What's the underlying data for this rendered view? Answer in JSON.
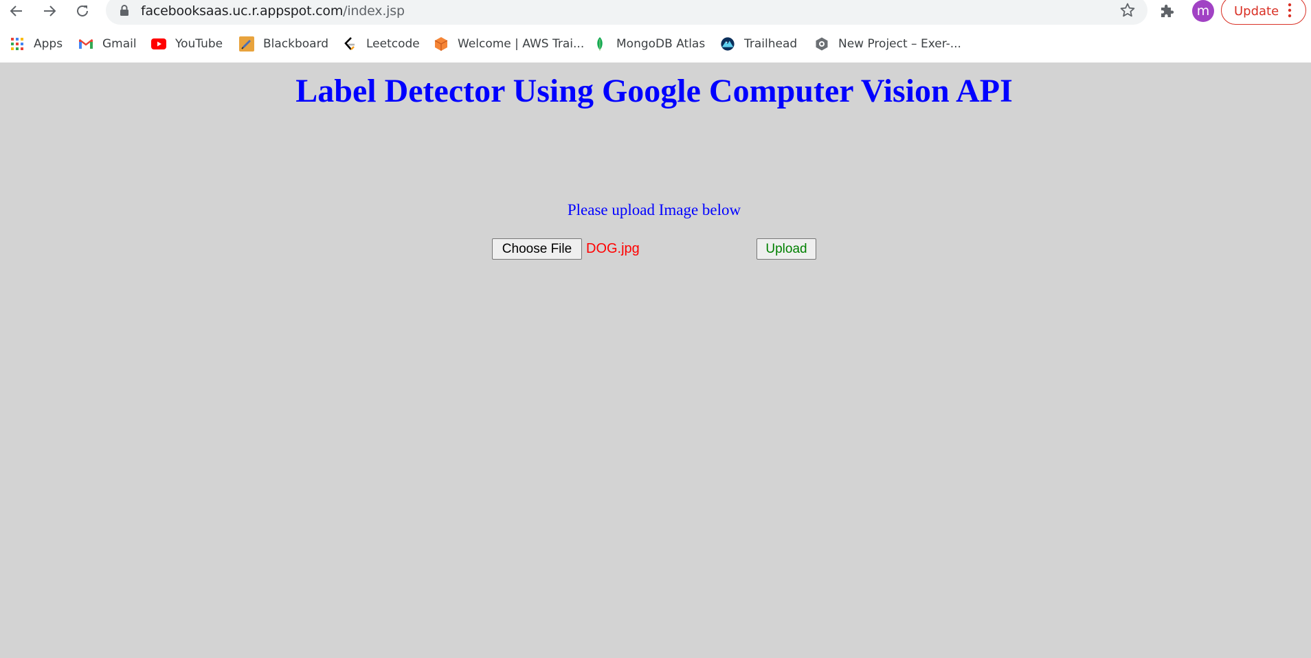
{
  "browser": {
    "url_host": "facebooksaas.uc.r.appspot.com",
    "url_path": "/index.jsp",
    "avatar_initial": "m",
    "update_label": "Update"
  },
  "bookmarks": [
    {
      "label": "Apps",
      "icon": "apps-grid-icon"
    },
    {
      "label": "Gmail",
      "icon": "gmail-icon"
    },
    {
      "label": "YouTube",
      "icon": "youtube-icon"
    },
    {
      "label": "Blackboard",
      "icon": "blackboard-icon"
    },
    {
      "label": "Leetcode",
      "icon": "leetcode-icon"
    },
    {
      "label": "Welcome | AWS Trai...",
      "icon": "aws-cube-icon"
    },
    {
      "label": "MongoDB Atlas",
      "icon": "mongodb-leaf-icon"
    },
    {
      "label": "Trailhead",
      "icon": "trailhead-icon"
    },
    {
      "label": "New Project – Exer-...",
      "icon": "hexagon-icon"
    }
  ],
  "page": {
    "title": "Label Detector Using Google Computer Vision API",
    "prompt": "Please upload Image below",
    "choose_file_label": "Choose File",
    "selected_file": "DOG.jpg",
    "upload_label": "Upload"
  },
  "colors": {
    "page_background": "#d3d3d3",
    "title_color": "#0000ff",
    "file_name_color": "#ff0000",
    "upload_text_color": "#008000",
    "update_accent": "#d93025",
    "avatar_bg": "#a142c4"
  }
}
